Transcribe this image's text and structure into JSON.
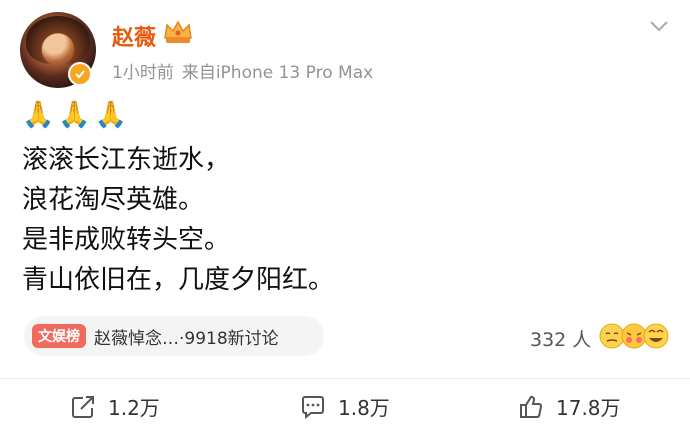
{
  "post": {
    "author": "赵薇",
    "time": "1小时前",
    "source": "来自iPhone 13 Pro Max",
    "emojis": [
      "🙏",
      "🙏",
      "🙏"
    ],
    "lines": [
      "滚滚长江东逝水，",
      "浪花淘尽英雄。",
      "是非成败转头空。",
      "青山依旧在，几度夕阳红。"
    ]
  },
  "topic": {
    "badge": "文娱榜",
    "text": "赵薇悼念…·9918新讨论"
  },
  "reactions": {
    "count": "332 人"
  },
  "actions": {
    "share": "1.2万",
    "comment": "1.8万",
    "like": "17.8万"
  },
  "colors": {
    "author_name": "#e8590c",
    "verified_badge": "#f5a623",
    "topic_badge": "#f06a5d",
    "meta_text": "#939393"
  },
  "icons": {
    "verified": "verified-badge-icon",
    "crown": "crown-icon",
    "more": "chevron-down-icon",
    "share": "share-icon",
    "comment": "comment-icon",
    "like": "thumbs-up-icon"
  }
}
